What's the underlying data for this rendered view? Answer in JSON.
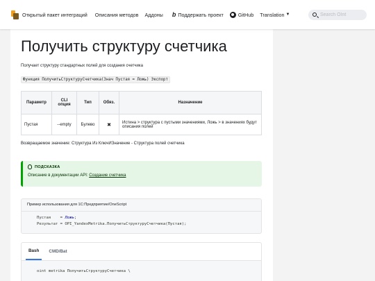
{
  "navbar": {
    "brand": "Открытый пакет интеграций",
    "items": [
      "Описания методов",
      "Аддоны"
    ],
    "support": "Поддержать проект",
    "github": "GitHub",
    "translation": "Translation",
    "search_placeholder": "Search OInt"
  },
  "page": {
    "title": "Получить структуру счетчика",
    "description": "Получает структуру стандартных полей для создания счетчика",
    "signature": "Функция ПолучитьСтруктуруСчетчика(Знач Пустая = Ложь) Экспорт"
  },
  "params_table": {
    "headers": [
      "Параметр",
      "CLI опция",
      "Тип",
      "Обяз.",
      "Назначение"
    ],
    "rows": [
      {
        "param": "Пустая",
        "cli": "--empty",
        "type": "Булево",
        "required": "✖",
        "purpose": "Истина > структура с пустыми значениями, Ложь > в значениях будут описания полей"
      }
    ]
  },
  "return_value": "Возвращаемое значение: Структура Из КлючИЗначение - Структура полей счетчика",
  "tip": {
    "title": "ПОДСКАЗКА",
    "text": "Описание в документации API: ",
    "link": "Создание счетчика"
  },
  "example": {
    "title": "Пример использования для 1С:Предприятие/OneScript",
    "line1_var": "Пустая    = ",
    "line1_val": "Ложь",
    "line1_end": ";",
    "line2": "Результат = OPI_YandexMetrika.ПолучитьСтруктуруСчетчика(Пустая);"
  },
  "cli_tabs": {
    "tabs": [
      "Bash",
      "CMD/Bat"
    ],
    "active": "Bash",
    "code": "oint metrika ПолучитьСтруктуруСчетчика \\"
  }
}
